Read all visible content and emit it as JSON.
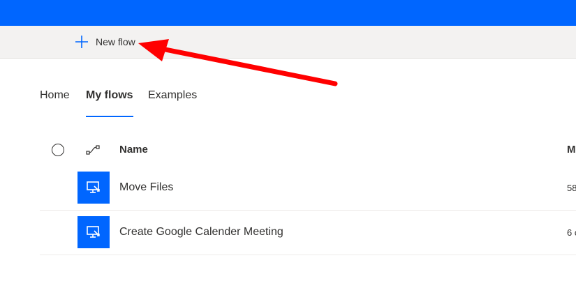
{
  "commandbar": {
    "new_flow_label": "New flow",
    "new_flow_icon": "plus-icon"
  },
  "tabs": [
    {
      "label": "Home",
      "active": false
    },
    {
      "label": "My flows",
      "active": true
    },
    {
      "label": "Examples",
      "active": false
    }
  ],
  "table": {
    "select_all_icon": "circle-checkbox-icon",
    "type_icon": "flow-connector-icon",
    "columns": {
      "name": "Name",
      "modified": "M"
    },
    "rows": [
      {
        "name": "Move Files",
        "modified": "58",
        "icon": "desktop-flow-icon"
      },
      {
        "name": "Create Google Calender Meeting",
        "modified": "6 c",
        "icon": "desktop-flow-icon"
      }
    ]
  },
  "colors": {
    "brand_blue": "#0066ff",
    "annotation_arrow": "#ff0000",
    "commandbar_bg": "#f3f2f1"
  }
}
